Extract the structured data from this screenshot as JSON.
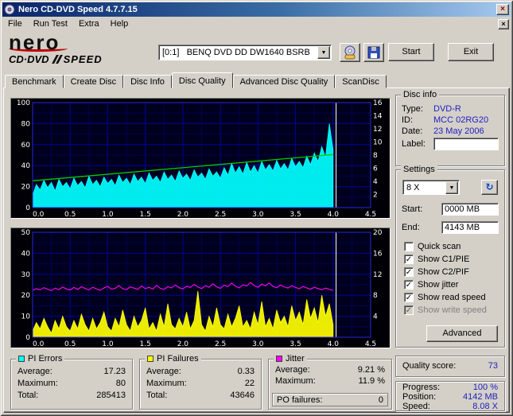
{
  "titlebar": {
    "title": "Nero CD-DVD Speed 4.7.7.15"
  },
  "icons": {
    "close": "×",
    "dropdown": "▼",
    "refresh": "↻"
  },
  "menubar": {
    "items": [
      "File",
      "Run Test",
      "Extra",
      "Help"
    ]
  },
  "toolbar": {
    "logo_nero": "nero",
    "logo_cddvd": "CD·DVD",
    "logo_speed": "SPEED",
    "drive": "[0:1]   BENQ DVD DD DW1640 BSRB",
    "start": "Start",
    "exit": "Exit"
  },
  "tabs": {
    "items": [
      "Benchmark",
      "Create Disc",
      "Disc Info",
      "Disc Quality",
      "Advanced Disc Quality",
      "ScanDisc"
    ],
    "active": "Disc Quality"
  },
  "disc_info": {
    "title": "Disc info",
    "type_label": "Type:",
    "type": "DVD-R",
    "id_label": "ID:",
    "id": "MCC 02RG20",
    "date_label": "Date:",
    "date": "23 May 2006",
    "label_label": "Label:",
    "label_value": ""
  },
  "settings": {
    "title": "Settings",
    "speed": "8 X",
    "start_label": "Start:",
    "start": "0000 MB",
    "end_label": "End:",
    "end": "4143 MB",
    "checks": [
      {
        "label": "Quick scan",
        "mark": ""
      },
      {
        "label": "Show C1/PIE",
        "mark": "✓"
      },
      {
        "label": "Show C2/PIF",
        "mark": "✓"
      },
      {
        "label": "Show jitter",
        "mark": "✓"
      },
      {
        "label": "Show read speed",
        "mark": "✓"
      },
      {
        "label": "Show write speed",
        "mark": "✓"
      }
    ],
    "advanced": "Advanced"
  },
  "quality": {
    "label": "Quality score:",
    "value": "73"
  },
  "progress": {
    "progress_label": "Progress:",
    "progress": "100 %",
    "position_label": "Position:",
    "position": "4142 MB",
    "speed_label": "Speed:",
    "speed": "8.08 X"
  },
  "stats": {
    "pi_errors": {
      "title": "PI Errors",
      "color": "#00ffff",
      "avg_label": "Average:",
      "avg": "17.23",
      "max_label": "Maximum:",
      "max": "80",
      "total_label": "Total:",
      "total": "285413"
    },
    "pi_failures": {
      "title": "PI Failures",
      "color": "#ffff00",
      "avg_label": "Average:",
      "avg": "0.33",
      "max_label": "Maximum:",
      "max": "22",
      "total_label": "Total:",
      "total": "43646"
    },
    "jitter": {
      "title": "Jitter",
      "color": "#ff00ff",
      "avg_label": "Average:",
      "avg": "9.21 %",
      "max_label": "Maximum:",
      "max": "11.9 %",
      "po_label": "PO failures:",
      "po": "0"
    }
  },
  "chart_data": [
    {
      "type": "area",
      "name": "pi-errors-vs-position",
      "y_max": 100,
      "y_major": 20,
      "y_minor": 10,
      "left_ticks": [
        100,
        80,
        60,
        40,
        20,
        0
      ],
      "right_max": 16,
      "right_ticks": [
        16,
        14,
        12,
        10,
        8,
        6,
        4,
        2
      ],
      "x_max": 4.5,
      "x_step": 0.5,
      "cursor_x": 4.04,
      "series": [
        {
          "name": "C1/PIE",
          "type": "area",
          "color": "#00ffff",
          "step": 0.05,
          "values": [
            12,
            22,
            17,
            26,
            19,
            24,
            16,
            27,
            20,
            24,
            18,
            28,
            21,
            25,
            19,
            30,
            22,
            26,
            20,
            29,
            23,
            27,
            21,
            31,
            24,
            28,
            22,
            32,
            25,
            29,
            23,
            33,
            26,
            30,
            24,
            34,
            27,
            31,
            25,
            35,
            28,
            32,
            26,
            36,
            29,
            33,
            27,
            37,
            30,
            34,
            28,
            38,
            31,
            42,
            33,
            39,
            32,
            43,
            34,
            40,
            33,
            44,
            36,
            41,
            35,
            45,
            37,
            42,
            36,
            47,
            39,
            44,
            38,
            49,
            41,
            52,
            44,
            58,
            48,
            80,
            55
          ]
        },
        {
          "name": "Read speed",
          "type": "segment",
          "color": "#00cc00",
          "points": [
            [
              0,
              25.5
            ],
            [
              4.0,
              50.5
            ]
          ]
        }
      ]
    },
    {
      "type": "area",
      "name": "pi-failures-jitter-vs-position",
      "y_max": 50,
      "y_major": 10,
      "y_minor": 5,
      "left_ticks": [
        50,
        40,
        30,
        20,
        10,
        0
      ],
      "right_max": 20,
      "right_ticks": [
        20,
        16,
        12,
        8,
        4
      ],
      "x_max": 4.5,
      "x_step": 0.5,
      "cursor_x": 4.04,
      "series": [
        {
          "name": "C2/PIF",
          "type": "area",
          "color": "#ffff00",
          "step": 0.05,
          "values": [
            3,
            7,
            4,
            9,
            5,
            2,
            8,
            4,
            10,
            5,
            3,
            8,
            4,
            11,
            6,
            3,
            9,
            4,
            7,
            12,
            5,
            3,
            9,
            5,
            13,
            6,
            3,
            10,
            5,
            8,
            14,
            4,
            7,
            3,
            11,
            5,
            16,
            6,
            4,
            9,
            5,
            12,
            4,
            8,
            22,
            6,
            3,
            10,
            5,
            14,
            6,
            4,
            11,
            5,
            9,
            15,
            5,
            8,
            4,
            12,
            6,
            17,
            5,
            9,
            4,
            13,
            7,
            10,
            5,
            15,
            8,
            12,
            6,
            18,
            9,
            14,
            7,
            20,
            10,
            16,
            6
          ]
        },
        {
          "name": "Jitter",
          "type": "line",
          "color": "#ff00ff",
          "step": 0.05,
          "values": [
            22.4,
            23.1,
            22.6,
            23.6,
            22.9,
            22.2,
            23.4,
            22.7,
            23.9,
            23.0,
            22.5,
            23.7,
            22.8,
            24.1,
            23.2,
            22.6,
            23.8,
            23.0,
            22.4,
            23.5,
            24.2,
            22.9,
            23.3,
            24.6,
            23.1,
            22.7,
            24.0,
            23.4,
            22.8,
            24.4,
            23.2,
            23.8,
            22.9,
            24.7,
            23.3,
            22.8,
            24.1,
            23.5,
            24.9,
            23.6,
            23.0,
            24.3,
            23.7,
            25.2,
            23.9,
            23.2,
            24.6,
            23.8,
            25.5,
            24.0,
            23.3,
            24.8,
            24.1,
            25.8,
            24.3,
            23.5,
            25.0,
            24.4,
            26.1,
            24.6,
            23.8,
            25.3,
            24.5,
            25.9,
            24.2,
            23.6,
            24.9,
            24.0,
            23.4,
            24.5,
            23.7,
            23.1,
            24.2,
            23.5,
            22.9,
            23.8,
            23.2,
            22.6,
            23.4,
            22.8,
            22.3
          ]
        }
      ]
    }
  ]
}
